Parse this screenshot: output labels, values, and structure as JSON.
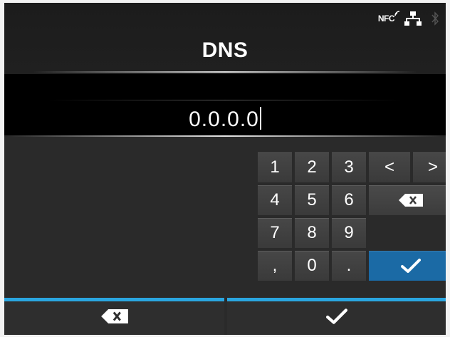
{
  "screen": {
    "title": "DNS",
    "input_value": "0.0.0.0"
  },
  "status_bar": {
    "nfc_label": "NFC",
    "icons": [
      "nfc-icon",
      "network-icon",
      "bluetooth-icon"
    ]
  },
  "keypad": {
    "digits_row1": [
      "1",
      "2",
      "3"
    ],
    "digits_row2": [
      "4",
      "5",
      "6"
    ],
    "digits_row3": [
      "7",
      "8",
      "9"
    ],
    "digits_row4": [
      ",",
      "0",
      "."
    ],
    "left_arrow": "<",
    "right_arrow": ">",
    "backspace_icon": "backspace-icon",
    "enter_icon": "checkmark-icon"
  },
  "bottom_bar": {
    "cancel_icon": "backspace-icon",
    "confirm_icon": "checkmark-icon"
  },
  "colors": {
    "accent_blue": "#1b6aa5",
    "bar_highlight": "#2aa6e0",
    "background": "#2a2a2a",
    "input_band": "#000000"
  }
}
